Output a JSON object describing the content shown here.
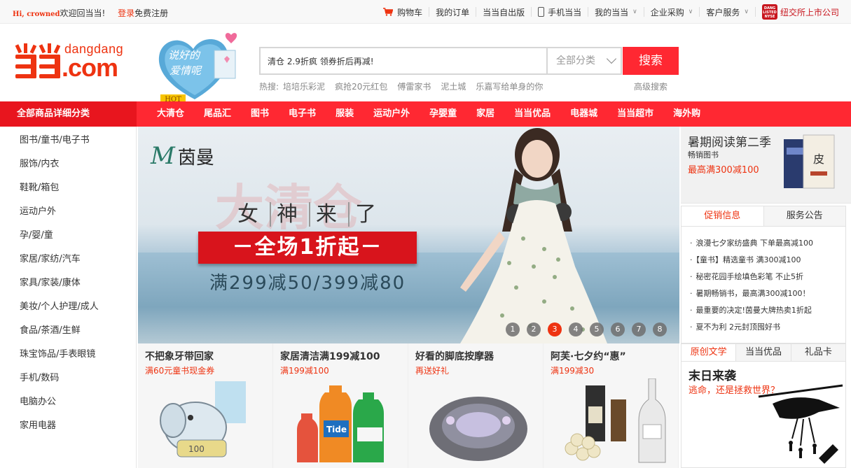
{
  "topbar": {
    "hi": "Hi, crowned",
    "welcome": "欢迎回当当!",
    "login": "登录",
    "register": "免费注册",
    "links": [
      "购物车",
      "我的订单",
      "当当自出版",
      "手机当当",
      "我的当当",
      "企业采购",
      "客户服务",
      "纽交所上市公司"
    ]
  },
  "logo": {
    "text": "dangdang",
    "domain": ".com"
  },
  "promo_heart": {
    "text": "说好的爱情呢"
  },
  "hot_badge": "HOT",
  "search": {
    "value": "清仓 2.9折疯 领券折后再减!",
    "category": "全部分类",
    "button": "搜索",
    "hot_label": "热搜:",
    "hot_words": [
      "培培乐彩泥",
      "疯抢20元红包",
      "傅雷家书",
      "泥土城",
      "乐嘉写给单身的你"
    ],
    "advanced": "高级搜索"
  },
  "rednav": {
    "all_categories": "全部商品详细分类",
    "items": [
      "大清仓",
      "尾品汇",
      "图书",
      "电子书",
      "服装",
      "运动户外",
      "孕婴童",
      "家居",
      "当当优品",
      "电器城",
      "当当超市",
      "海外购"
    ]
  },
  "left_categories": [
    "图书/童书/电子书",
    "服饰/内衣",
    "鞋靴/箱包",
    "运动户外",
    "孕/婴/童",
    "家居/家纺/汽车",
    "家具/家装/康体",
    "美妆/个人护理/成人",
    "食品/茶酒/生鲜",
    "珠宝饰品/手表眼镜",
    "手机/数码",
    "电脑办公",
    "家用电器"
  ],
  "banner": {
    "brand_m": "M",
    "brand_name": "茵曼",
    "tagline": [
      "女",
      "神",
      "来",
      "了"
    ],
    "strip": "－全场1折起－",
    "offer": "满299减50/399减80",
    "dots": [
      "1",
      "2",
      "3",
      "4",
      "5",
      "6",
      "7",
      "8"
    ],
    "active_dot": 3
  },
  "tiles": [
    {
      "title": "不把象牙带回家",
      "sub": "满60元童书现金券"
    },
    {
      "title": "家居清洁满199减100",
      "sub": "满199减100"
    },
    {
      "title": "好看的脚底按摩器",
      "sub": "再送好礼"
    },
    {
      "title": "阿芙·七夕约“惠”",
      "sub": "满199减30"
    }
  ],
  "right": {
    "read_title": "暑期阅读第二季",
    "read_sub": "畅销图书",
    "read_promo": "最高满300减100",
    "tabs1": [
      "促销信息",
      "服务公告"
    ],
    "notices": [
      "浪漫七夕家纺盛典 下单最高减100",
      "【童书】精选童书 满300减100",
      "秘密花园手绘填色彩笔 不止5折",
      "暑期畅销书，最高满300减100！",
      "最重要的决定!茵曼大牌热卖1折起",
      "夏不为利 2元封顶囤好书"
    ],
    "tabs2": [
      "原创文学",
      "当当优品",
      "礼品卡"
    ],
    "story_title": "末日来袭",
    "story_sub": "逃命，还是拯救世界？"
  },
  "colors": {
    "brand_red": "#ff2832",
    "accent_red": "#e31"
  }
}
